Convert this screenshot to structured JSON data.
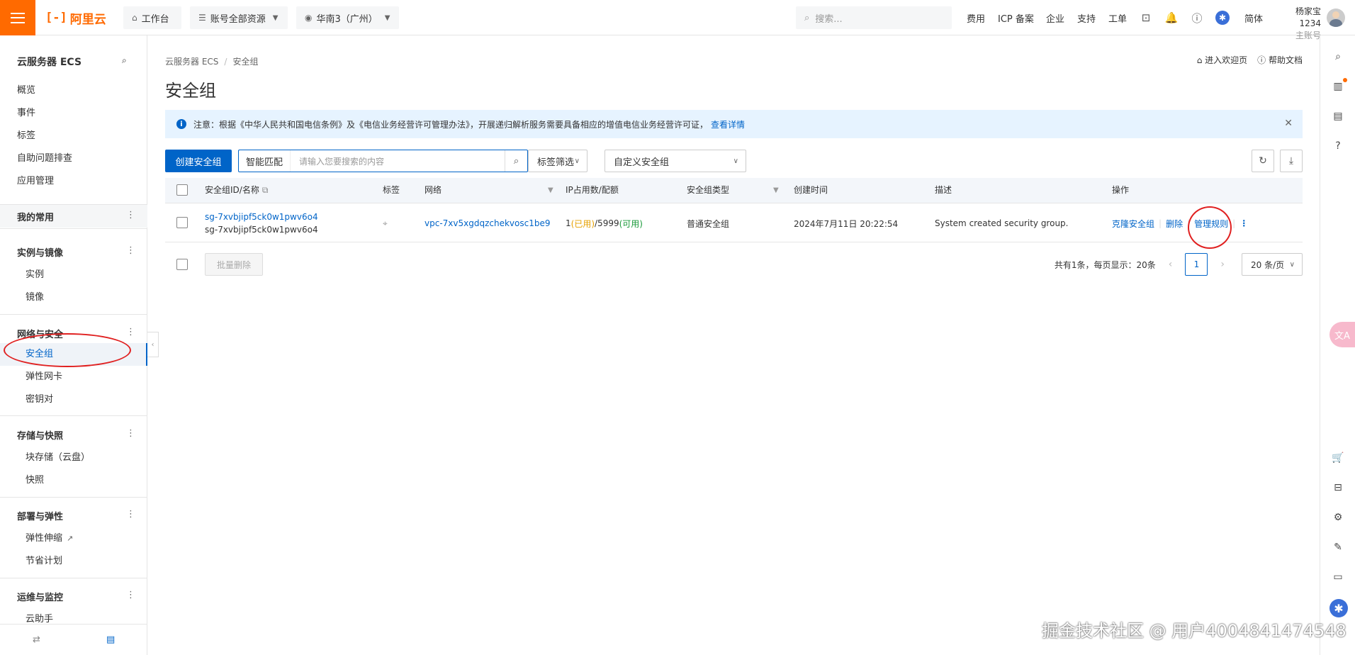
{
  "topbar": {
    "logo": "阿里云",
    "logo_mark": "[-]",
    "workbench": "工作台",
    "account_resources": "账号全部资源",
    "region": "华南3（广州）",
    "search_placeholder": "搜索...",
    "nav": [
      "费用",
      "ICP 备案",
      "企业",
      "支持",
      "工单"
    ],
    "lang": "简体",
    "user_name": "杨家宝1234",
    "user_role": "主账号"
  },
  "sidebar": {
    "title": "云服务器 ECS",
    "top_items": [
      "概览",
      "事件",
      "标签",
      "自助问题排查",
      "应用管理"
    ],
    "favorites": "我的常用",
    "groups": [
      {
        "title": "实例与镜像",
        "items": [
          "实例",
          "镜像"
        ]
      },
      {
        "title": "网络与安全",
        "items": [
          "安全组",
          "弹性网卡",
          "密钥对"
        ]
      },
      {
        "title": "存储与快照",
        "items": [
          "块存储（云盘）",
          "快照"
        ]
      },
      {
        "title": "部署与弹性",
        "items": [
          "弹性伸缩",
          "节省计划"
        ]
      },
      {
        "title": "运维与监控",
        "items": [
          "云助手"
        ]
      }
    ]
  },
  "main": {
    "breadcrumb": [
      "云服务器 ECS",
      "安全组"
    ],
    "title": "安全组",
    "top_links": [
      "进入欢迎页",
      "帮助文档"
    ],
    "notice_text": "注意：根据《中华人民共和国电信条例》及《电信业务经营许可管理办法》，开展递归解析服务需要具备相应的增值电信业务经营许可证，",
    "notice_link": "查看详情",
    "create_button": "创建安全组",
    "search_mode": "智能匹配",
    "search_placeholder": "请输入您要搜索的内容",
    "tag_filter": "标签筛选",
    "custom_sg": "自定义安全组",
    "columns": [
      "安全组ID/名称",
      "标签",
      "网络",
      "IP占用数/配额",
      "安全组类型",
      "创建时间",
      "描述",
      "操作"
    ],
    "row": {
      "id": "sg-7xvbjipf5ck0w1pwv6o4",
      "name": "sg-7xvbjipf5ck0w1pwv6o4",
      "vpc": "vpc-7xv5xgdqzchekvosc1be9",
      "ip_used_count": "1",
      "ip_used_label": "(已用)",
      "ip_quota": "/5999",
      "ip_avail_label": "(可用)",
      "type": "普通安全组",
      "created": "2024年7月11日 20:22:54",
      "description": "System created security group.",
      "actions": [
        "克隆安全组",
        "删除",
        "管理规则"
      ]
    },
    "batch_delete": "批量删除",
    "pager_total": "共有1条，每页显示：20条",
    "page": "1",
    "page_size": "20 条/页"
  },
  "watermark": "掘金技术社区 @ 用户4004841474548",
  "translate_float": "文A",
  "colors": {
    "brand": "#ff6a00",
    "primary": "#0064c8",
    "used": "#e6a000",
    "available": "#1a9a3a",
    "mark": "#e02020"
  }
}
